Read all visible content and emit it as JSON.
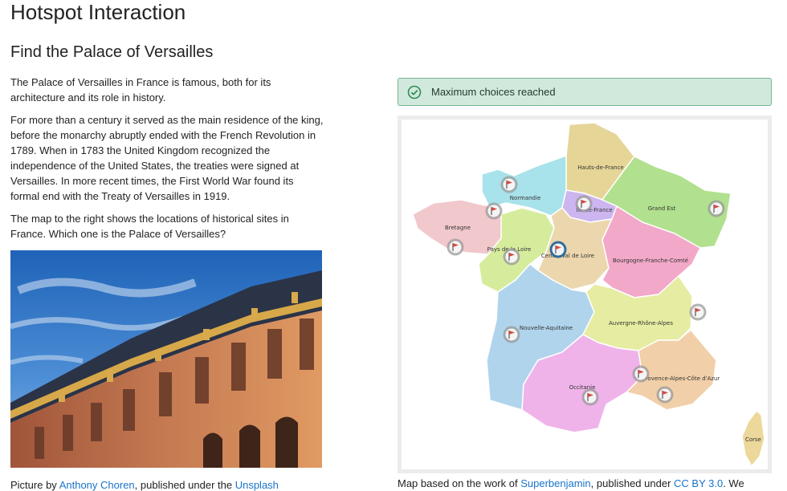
{
  "header": {
    "title": "Hotspot Interaction"
  },
  "question": {
    "title": "Find the Palace of Versailles",
    "paragraphs": [
      "The Palace of Versailles in France is famous, both for its architecture and its role in history.",
      "For more than a century it served as the main residence of the king, before the monarchy abruptly ended with the French Revolution in 1789. When in 1783 the United Kingdom recognized the independence of the United States, the treaties were signed at Versailles. In more recent times, the First World War found its formal end with the Treaty of Versailles in 1919.",
      "The map to the right shows the locations of historical sites in France. Which one is the Palace of Versailles?"
    ],
    "photo_caption": {
      "prefix": "Picture by ",
      "author": "Anthony Choren",
      "middle": ", published under the ",
      "license": "Unsplash"
    }
  },
  "alert": {
    "text": "Maximum choices reached",
    "color": "#d1e9dc"
  },
  "map": {
    "regions": [
      {
        "id": "hauts-de-france",
        "label": "Hauts-de-France",
        "color": "#e5d597"
      },
      {
        "id": "normandie",
        "label": "Normandie",
        "color": "#a8e2ea"
      },
      {
        "id": "ile-de-france",
        "label": "Île-de-France",
        "color": "#cdb5ef"
      },
      {
        "id": "grand-est",
        "label": "Grand Est",
        "color": "#b1e08e"
      },
      {
        "id": "bretagne",
        "label": "Bretagne",
        "color": "#f1c8cc"
      },
      {
        "id": "pays-de-la-loire",
        "label": "Pays de la Loire",
        "color": "#d6ec9d"
      },
      {
        "id": "centre-val-de-loire",
        "label": "Centre-Val de Loire",
        "color": "#ecd6ad"
      },
      {
        "id": "bourgogne-franche-comte",
        "label": "Bourgogne-Franche-Comté",
        "color": "#f2a8c9"
      },
      {
        "id": "nouvelle-aquitaine",
        "label": "Nouvelle-Aquitaine",
        "color": "#b0d4ec"
      },
      {
        "id": "auvergne-rhone-alpes",
        "label": "Auvergne-Rhône-Alpes",
        "color": "#e6eca1"
      },
      {
        "id": "occitanie",
        "label": "Occitanie",
        "color": "#efb3ea"
      },
      {
        "id": "provence-alpes-cote-dazur",
        "label": "Provence-Alpes-Côte d'Azur",
        "color": "#f1cfa8"
      },
      {
        "id": "corse",
        "label": "Corse",
        "color": "#ecd89a"
      }
    ],
    "hotspot_selected_color": "#2f6e9c",
    "hotspot_color": "#9a9a9a",
    "flag_color": "#d54a44"
  },
  "map_caption": {
    "prefix": "Map based on the work of ",
    "author": "Superbenjamin",
    "middle": ", published under ",
    "license": "CC BY 3.0",
    "suffix": ". We"
  }
}
